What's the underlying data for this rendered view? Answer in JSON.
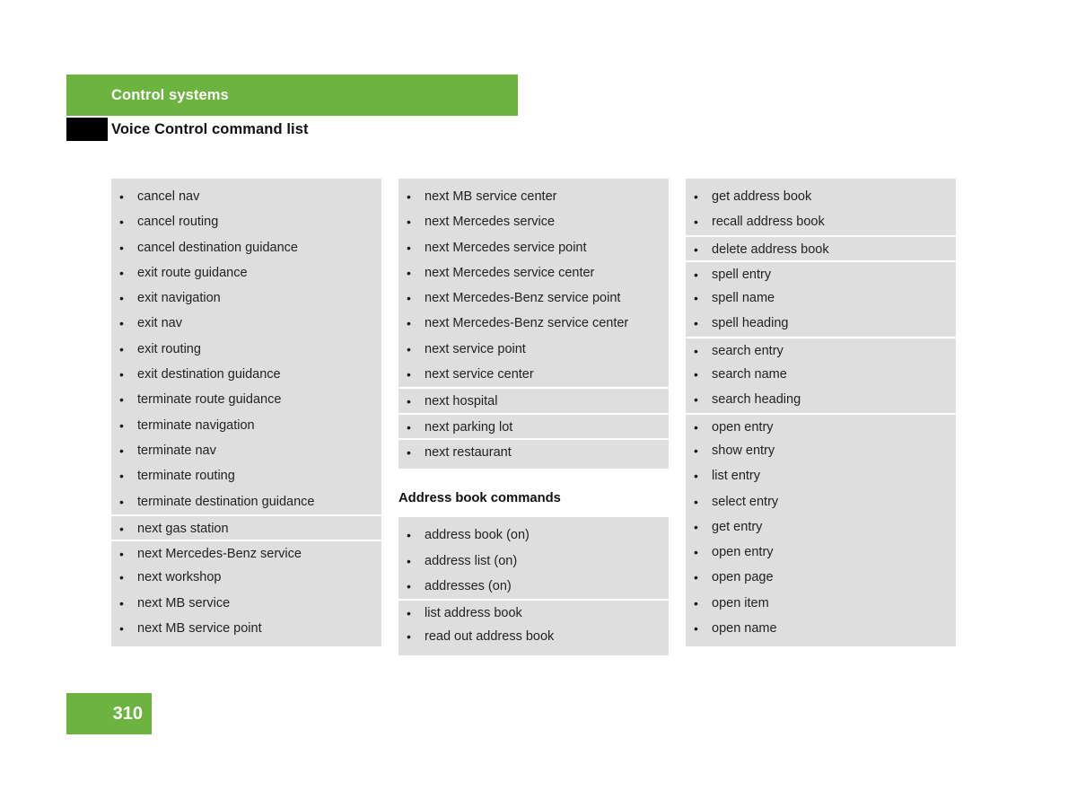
{
  "header": {
    "chapter_title": "Control systems",
    "section_title": "Voice Control command list",
    "bar_color": "#6cb33f",
    "marker_color": "#000000"
  },
  "footer": {
    "page_number": "310",
    "box_color": "#6cb33f"
  },
  "bullet_glyph": "•",
  "columns": [
    {
      "name": "column-1",
      "groups": [
        {
          "items": [
            "cancel nav",
            "cancel routing",
            "cancel destination guidance",
            "exit route guidance",
            "exit navigation",
            "exit nav",
            "exit routing",
            "exit destination guidance",
            "terminate route guidance",
            "terminate navigation",
            "terminate nav",
            "terminate routing",
            "terminate destination guidance"
          ]
        },
        {
          "items": [
            "next gas station"
          ]
        },
        {
          "items": [
            "next Mercedes-Benz service",
            "next workshop",
            "next MB service",
            "next MB service point"
          ]
        }
      ]
    },
    {
      "name": "column-2",
      "groups": [
        {
          "items": [
            "next MB service center",
            "next Mercedes service",
            "next Mercedes service point",
            "next Mercedes service center",
            "next Mercedes-Benz service point",
            "next Mercedes-Benz service center",
            "next service point",
            "next service center"
          ]
        },
        {
          "items": [
            "next hospital"
          ]
        },
        {
          "items": [
            "next parking lot"
          ]
        },
        {
          "items": [
            "next restaurant"
          ]
        }
      ],
      "section": {
        "heading": "Address book commands",
        "groups": [
          {
            "items": [
              "address book (on)",
              "address list (on)",
              "addresses (on)"
            ]
          },
          {
            "items": [
              "list address book",
              "read out address book"
            ]
          }
        ]
      }
    },
    {
      "name": "column-3",
      "groups": [
        {
          "items": [
            "get address book",
            "recall address book"
          ]
        },
        {
          "items": [
            "delete address book"
          ]
        },
        {
          "items": [
            "spell entry",
            "spell name",
            "spell heading"
          ]
        },
        {
          "items": [
            "search entry",
            "search name",
            "search heading"
          ]
        },
        {
          "items": [
            "open entry",
            "show entry",
            "list entry",
            "select entry",
            "get entry",
            "open entry",
            "open page",
            "open item",
            "open name"
          ]
        }
      ]
    }
  ]
}
